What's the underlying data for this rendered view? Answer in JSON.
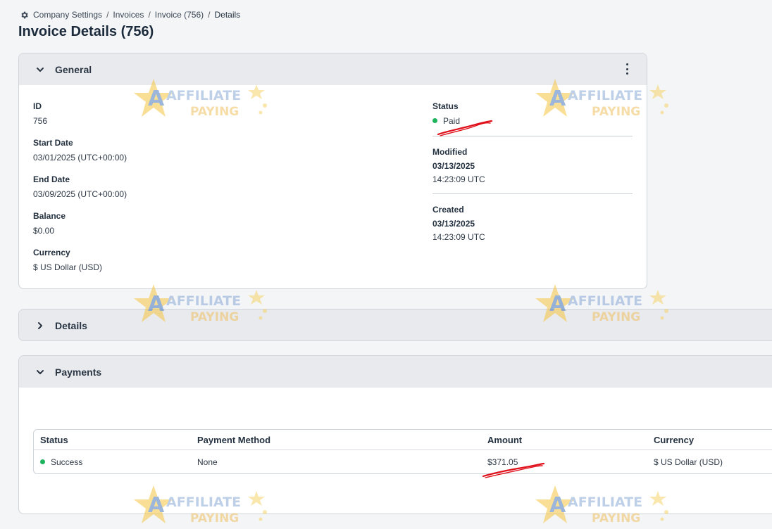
{
  "breadcrumb": {
    "items": [
      "Company Settings",
      "Invoices",
      "Invoice (756)",
      "Details"
    ],
    "separator": "/"
  },
  "page": {
    "title": "Invoice Details (756)"
  },
  "general": {
    "header": "General",
    "left_fields": [
      {
        "label": "ID",
        "value": "756"
      },
      {
        "label": "Start Date",
        "value": "03/01/2025 (UTC+00:00)"
      },
      {
        "label": "End Date",
        "value": "03/09/2025 (UTC+00:00)"
      },
      {
        "label": "Balance",
        "value": "$0.00"
      },
      {
        "label": "Currency",
        "value": "$ US Dollar (USD)"
      }
    ],
    "status": {
      "label": "Status",
      "value": "Paid",
      "color": "#1fb35e"
    },
    "modified": {
      "label": "Modified",
      "date": "03/13/2025",
      "time": "14:23:09 UTC"
    },
    "created": {
      "label": "Created",
      "date": "03/13/2025",
      "time": "14:23:09 UTC"
    }
  },
  "details": {
    "header": "Details"
  },
  "payments": {
    "header": "Payments",
    "columns": [
      "Status",
      "Payment Method",
      "Amount",
      "Currency"
    ],
    "rows": [
      {
        "status": "Success",
        "method": "None",
        "amount": "$371.05",
        "currency": "$ US Dollar (USD)"
      }
    ]
  },
  "watermark": {
    "line1": "AFFILIATE",
    "line2": "PAYING"
  },
  "colors": {
    "accent_status": "#1fb35e",
    "annotation": "#e0101a",
    "header_bg": "#e9eaed"
  }
}
